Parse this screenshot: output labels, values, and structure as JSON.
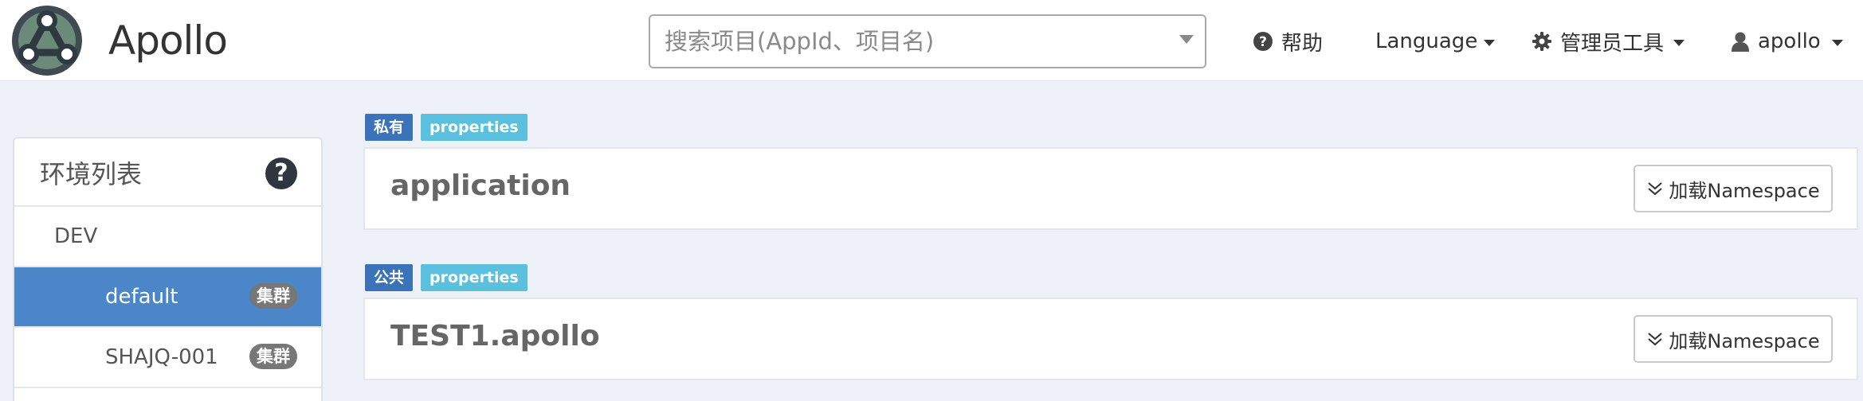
{
  "brand": {
    "name": "Apollo",
    "icon": "apollo-logo"
  },
  "search": {
    "placeholder": "搜索项目(AppId、项目名)",
    "value": ""
  },
  "nav": {
    "help_label": "帮助",
    "help_icon": "question-circle-icon",
    "language_label": "Language",
    "admin_tools_label": "管理员工具",
    "admin_icon": "gear-icon",
    "user_label": "apollo",
    "user_icon": "user-icon"
  },
  "sidebar": {
    "title": "环境列表",
    "help_icon": "question-circle-icon",
    "environments": [
      {
        "name": "DEV",
        "clusters": [
          {
            "name": "default",
            "badge": "集群",
            "active": true
          },
          {
            "name": "SHAJQ-001",
            "badge": "集群",
            "active": false
          }
        ]
      }
    ]
  },
  "namespaces": [
    {
      "scope_tag": "私有",
      "format_tag": "properties",
      "name": "application",
      "load_button": "加载Namespace"
    },
    {
      "scope_tag": "公共",
      "format_tag": "properties",
      "name": "TEST1.apollo",
      "load_button": "加载Namespace"
    }
  ],
  "colors": {
    "active_cluster": "#4a86c8",
    "private_tag": "#3b73b9",
    "format_tag": "#5bc0de",
    "page_background": "#eef1f7"
  }
}
